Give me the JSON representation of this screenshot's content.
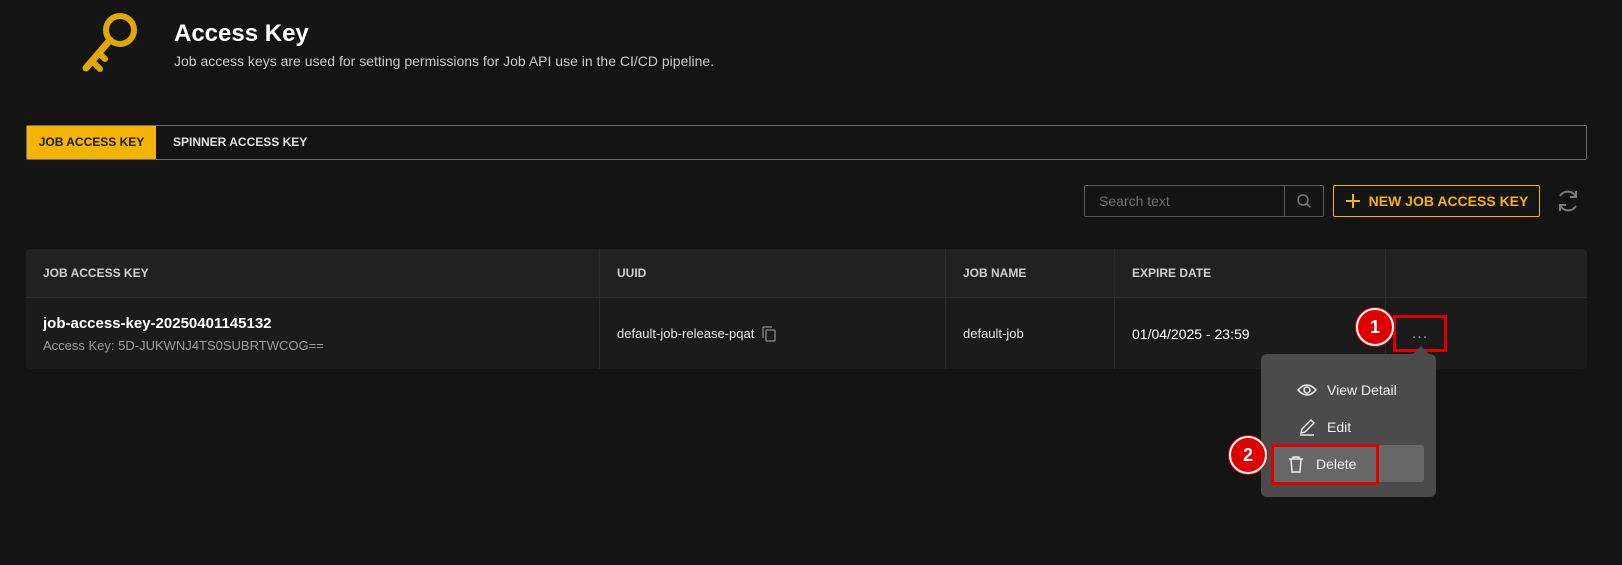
{
  "header": {
    "title": "Access Key",
    "subtitle": "Job access keys are used for setting permissions for Job API use in the CI/CD pipeline.",
    "icon": "key-icon"
  },
  "tabs": [
    {
      "label": "JOB ACCESS KEY",
      "active": true
    },
    {
      "label": "SPINNER ACCESS KEY",
      "active": false
    }
  ],
  "toolbar": {
    "search_placeholder": "Search text",
    "new_button_label": "NEW JOB ACCESS KEY"
  },
  "table": {
    "columns": [
      "JOB ACCESS KEY",
      "UUID",
      "JOB NAME",
      "EXPIRE DATE",
      ""
    ],
    "rows": [
      {
        "key_name": "job-access-key-20250401145132",
        "access_key": "Access Key: 5D-JUKWNJ4TS0SUBRTWCOG==",
        "uuid": "default-job-release-pqat",
        "job_name": "default-job",
        "expire_date": "01/04/2025 - 23:59",
        "actions": "..."
      }
    ]
  },
  "menu": {
    "items": [
      {
        "label": "View Detail",
        "icon": "eye-icon"
      },
      {
        "label": "Edit",
        "icon": "pencil-icon"
      },
      {
        "label": "Delete",
        "icon": "trash-icon"
      }
    ]
  },
  "markers": [
    "1",
    "2"
  ],
  "colors": {
    "accent": "#f5b400",
    "background": "#141414",
    "annotation": "#e10000"
  }
}
